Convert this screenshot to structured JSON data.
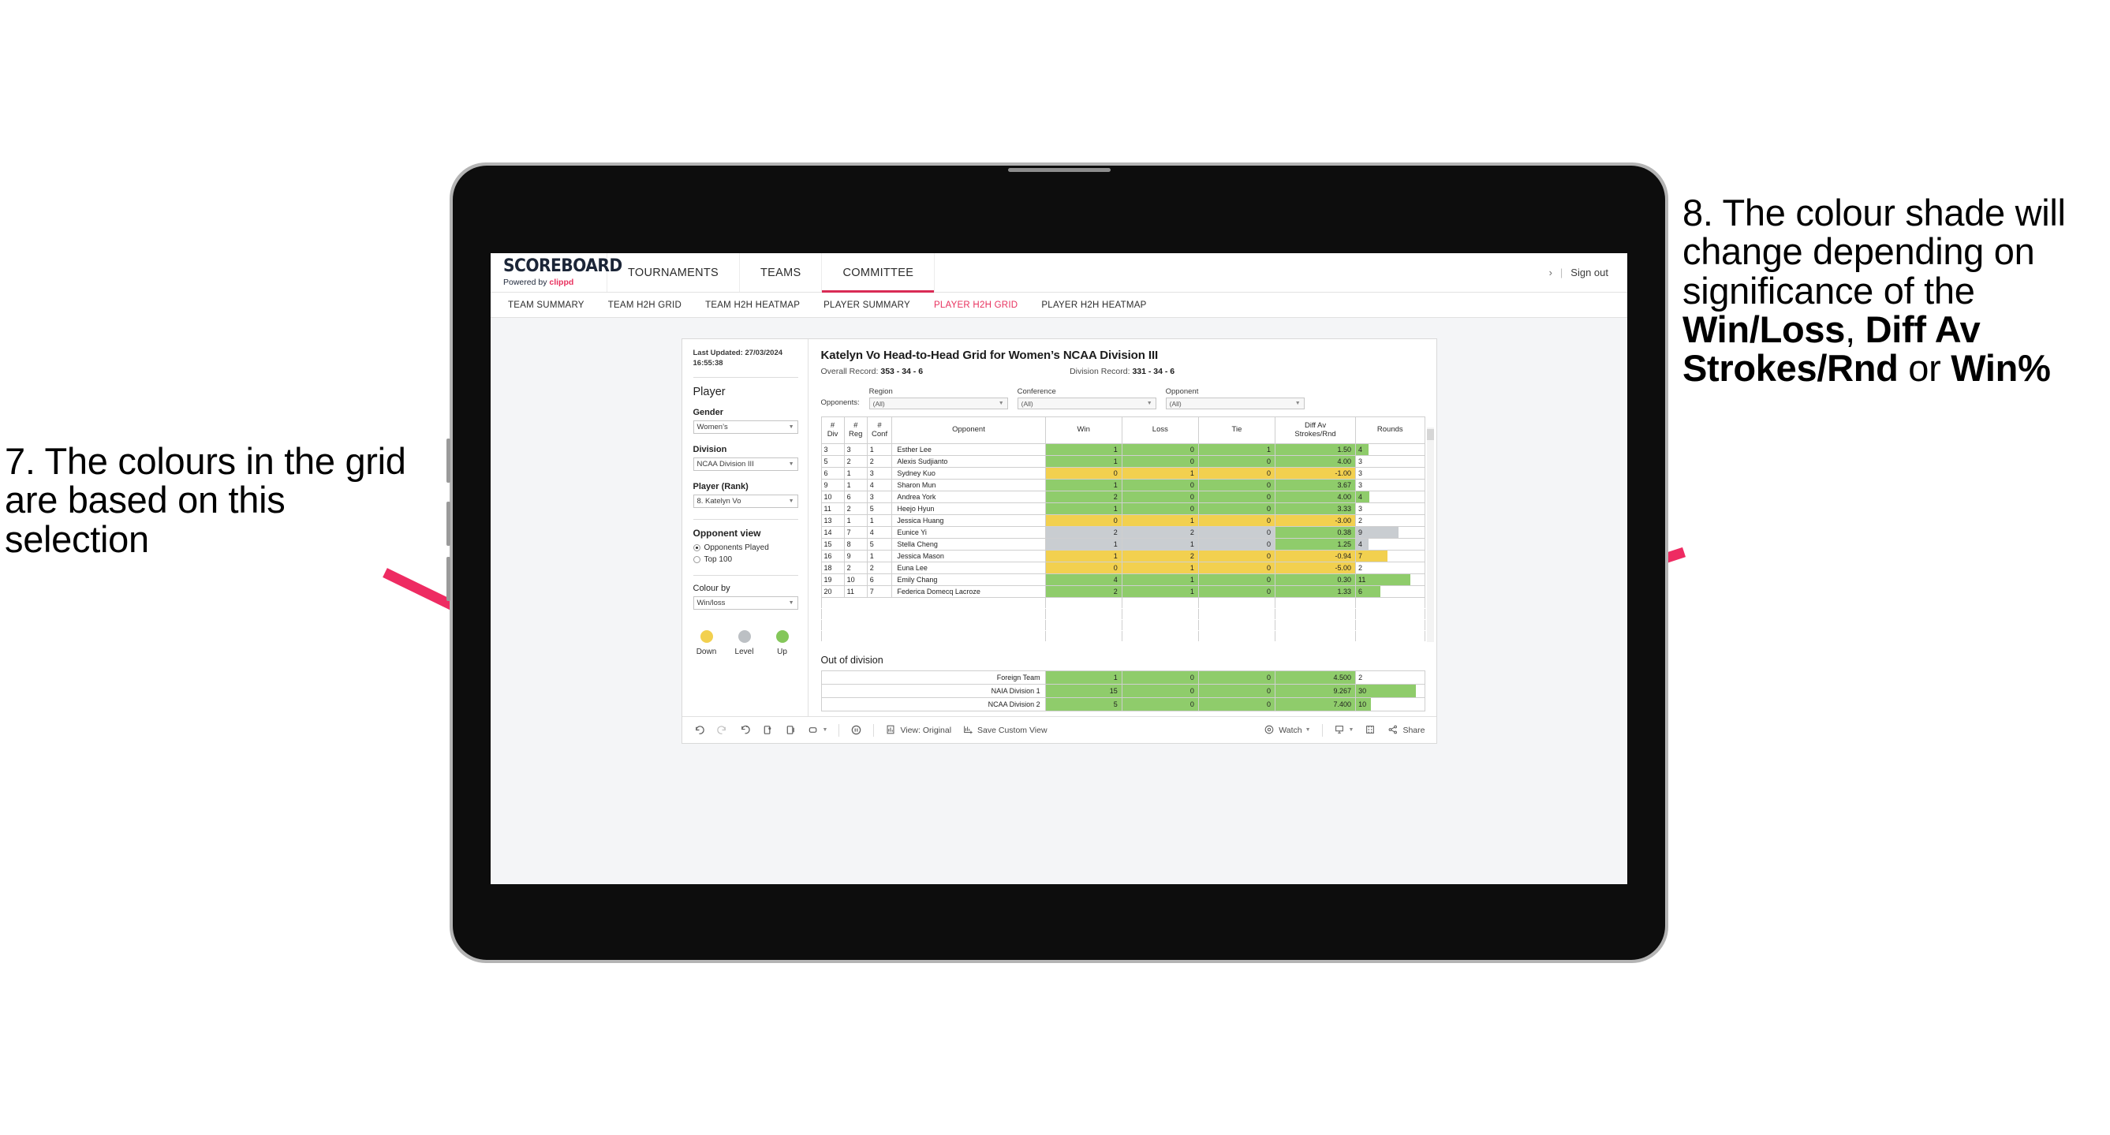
{
  "annotations": {
    "left": {
      "id": "annotation-7",
      "text": "7. The colours in the grid are based on this selection"
    },
    "right": {
      "id": "annotation-8",
      "line1": "8. The colour shade will change depending on significance of the ",
      "bold1": "Win/Loss",
      "mid1": ", ",
      "bold2": "Diff Av Strokes/Rnd",
      "mid2": " or ",
      "bold3": "Win%"
    },
    "arrow_color": "#ee2b62"
  },
  "header": {
    "brand_title": "SCOREBOARD",
    "brand_sub_prefix": "Powered by ",
    "brand_sub_link": "clippd",
    "nav": [
      {
        "label": "TOURNAMENTS",
        "active": false
      },
      {
        "label": "TEAMS",
        "active": false
      },
      {
        "label": "COMMITTEE",
        "active": true
      }
    ],
    "chevron": "›",
    "divider": "|",
    "sign_out": "Sign out"
  },
  "subnav": [
    {
      "label": "TEAM SUMMARY",
      "active": false
    },
    {
      "label": "TEAM H2H GRID",
      "active": false
    },
    {
      "label": "TEAM H2H HEATMAP",
      "active": false
    },
    {
      "label": "PLAYER SUMMARY",
      "active": false
    },
    {
      "label": "PLAYER H2H GRID",
      "active": true
    },
    {
      "label": "PLAYER H2H HEATMAP",
      "active": false
    }
  ],
  "sidebar": {
    "last_updated": "Last Updated: 27/03/2024 16:55:38",
    "section_player": "Player",
    "gender": {
      "label": "Gender",
      "value": "Women’s"
    },
    "division": {
      "label": "Division",
      "value": "NCAA Division III"
    },
    "player_rank": {
      "label": "Player (Rank)",
      "value": "8. Katelyn Vo"
    },
    "opponent_view": {
      "label": "Opponent view",
      "options": [
        {
          "label": "Opponents Played",
          "selected": true
        },
        {
          "label": "Top 100",
          "selected": false
        }
      ]
    },
    "colour_by": {
      "label": "Colour by",
      "value": "Win/loss"
    },
    "legend": [
      {
        "label": "Down",
        "color": "#f2d04f"
      },
      {
        "label": "Level",
        "color": "#bcc0c4"
      },
      {
        "label": "Up",
        "color": "#84c75a"
      }
    ]
  },
  "main": {
    "title": "Katelyn Vo Head-to-Head Grid for Women’s NCAA Division III",
    "overall_record_label": "Overall Record: ",
    "overall_record_value": "353 -  34 - 6",
    "division_record_label": "Division Record: ",
    "division_record_value": "331 -  34 - 6",
    "opponents_label": "Opponents:",
    "filters": [
      {
        "caption": "Region",
        "value": "(All)"
      },
      {
        "caption": "Conference",
        "value": "(All)"
      },
      {
        "caption": "Opponent",
        "value": "(All)"
      }
    ],
    "columns": [
      {
        "l1": "#",
        "l2": "Div"
      },
      {
        "l1": "#",
        "l2": "Reg"
      },
      {
        "l1": "#",
        "l2": "Conf"
      },
      {
        "l1": "Opponent",
        "l2": ""
      },
      {
        "l1": "Win",
        "l2": ""
      },
      {
        "l1": "Loss",
        "l2": ""
      },
      {
        "l1": "Tie",
        "l2": ""
      },
      {
        "l1": "Diff Av",
        "l2": "Strokes/Rnd"
      },
      {
        "l1": "Rounds",
        "l2": ""
      }
    ],
    "rows": [
      {
        "div": "3",
        "reg": "3",
        "conf": "1",
        "opponent": "Esther Lee",
        "win": "1",
        "loss": "0",
        "tie": "1",
        "diff": "1.50",
        "rounds": "4",
        "rounds_pct": 18,
        "color": "#8fcc6b"
      },
      {
        "div": "5",
        "reg": "2",
        "conf": "2",
        "opponent": "Alexis Sudjianto",
        "win": "1",
        "loss": "0",
        "tie": "0",
        "diff": "4.00",
        "rounds": "3",
        "rounds_pct": 0,
        "color": "#8fcc6b"
      },
      {
        "div": "6",
        "reg": "1",
        "conf": "3",
        "opponent": "Sydney Kuo",
        "win": "0",
        "loss": "1",
        "tie": "0",
        "diff": "-1.00",
        "rounds": "3",
        "rounds_pct": 0,
        "color": "#f2d04f"
      },
      {
        "div": "9",
        "reg": "1",
        "conf": "4",
        "opponent": "Sharon Mun",
        "win": "1",
        "loss": "0",
        "tie": "0",
        "diff": "3.67",
        "rounds": "3",
        "rounds_pct": 0,
        "color": "#8fcc6b"
      },
      {
        "div": "10",
        "reg": "6",
        "conf": "3",
        "opponent": "Andrea York",
        "win": "2",
        "loss": "0",
        "tie": "0",
        "diff": "4.00",
        "rounds": "4",
        "rounds_pct": 20,
        "color": "#8fcc6b"
      },
      {
        "div": "11",
        "reg": "2",
        "conf": "5",
        "opponent": "Heejo Hyun",
        "win": "1",
        "loss": "0",
        "tie": "0",
        "diff": "3.33",
        "rounds": "3",
        "rounds_pct": 0,
        "color": "#8fcc6b"
      },
      {
        "div": "13",
        "reg": "1",
        "conf": "1",
        "opponent": "Jessica Huang",
        "win": "0",
        "loss": "1",
        "tie": "0",
        "diff": "-3.00",
        "rounds": "2",
        "rounds_pct": 0,
        "color": "#f2d04f"
      },
      {
        "div": "14",
        "reg": "7",
        "conf": "4",
        "opponent": "Eunice Yi",
        "win": "2",
        "loss": "2",
        "tie": "0",
        "diff": "0.38",
        "rounds": "9",
        "rounds_pct": 62,
        "color": "#c9cdd1",
        "diff_color": "#8fcc6b"
      },
      {
        "div": "15",
        "reg": "8",
        "conf": "5",
        "opponent": "Stella Cheng",
        "win": "1",
        "loss": "1",
        "tie": "0",
        "diff": "1.25",
        "rounds": "4",
        "rounds_pct": 18,
        "color": "#c9cdd1",
        "diff_color": "#8fcc6b"
      },
      {
        "div": "16",
        "reg": "9",
        "conf": "1",
        "opponent": "Jessica Mason",
        "win": "1",
        "loss": "2",
        "tie": "0",
        "diff": "-0.94",
        "rounds": "7",
        "rounds_pct": 46,
        "color": "#f2d04f"
      },
      {
        "div": "18",
        "reg": "2",
        "conf": "2",
        "opponent": "Euna Lee",
        "win": "0",
        "loss": "1",
        "tie": "0",
        "diff": "-5.00",
        "rounds": "2",
        "rounds_pct": 0,
        "color": "#f2d04f"
      },
      {
        "div": "19",
        "reg": "10",
        "conf": "6",
        "opponent": "Emily Chang",
        "win": "4",
        "loss": "1",
        "tie": "0",
        "diff": "0.30",
        "rounds": "11",
        "rounds_pct": 80,
        "color": "#8fcc6b"
      },
      {
        "div": "20",
        "reg": "11",
        "conf": "7",
        "opponent": "Federica Domecq Lacroze",
        "win": "2",
        "loss": "1",
        "tie": "0",
        "diff": "1.33",
        "rounds": "6",
        "rounds_pct": 36,
        "color": "#8fcc6b"
      }
    ],
    "out_of_division": {
      "title": "Out of division",
      "rows": [
        {
          "label": "Foreign Team",
          "win": "1",
          "loss": "0",
          "tie": "0",
          "diff": "4.500",
          "rounds": "2",
          "rounds_pct": 0,
          "color": "#8fcc6b"
        },
        {
          "label": "NAIA Division 1",
          "win": "15",
          "loss": "0",
          "tie": "0",
          "diff": "9.267",
          "rounds": "30",
          "rounds_pct": 88,
          "color": "#8fcc6b"
        },
        {
          "label": "NCAA Division 2",
          "win": "5",
          "loss": "0",
          "tie": "0",
          "diff": "7.400",
          "rounds": "10",
          "rounds_pct": 22,
          "color": "#8fcc6b"
        }
      ]
    }
  },
  "toolbar": {
    "undo": "undo-icon",
    "redo": "redo-icon",
    "revert": "revert-icon",
    "refresh": "refresh-icon",
    "pause": "pause-icon",
    "view_label": "View: Original",
    "save_label": "Save Custom View",
    "watch_label": "Watch",
    "share_label": "Share"
  }
}
